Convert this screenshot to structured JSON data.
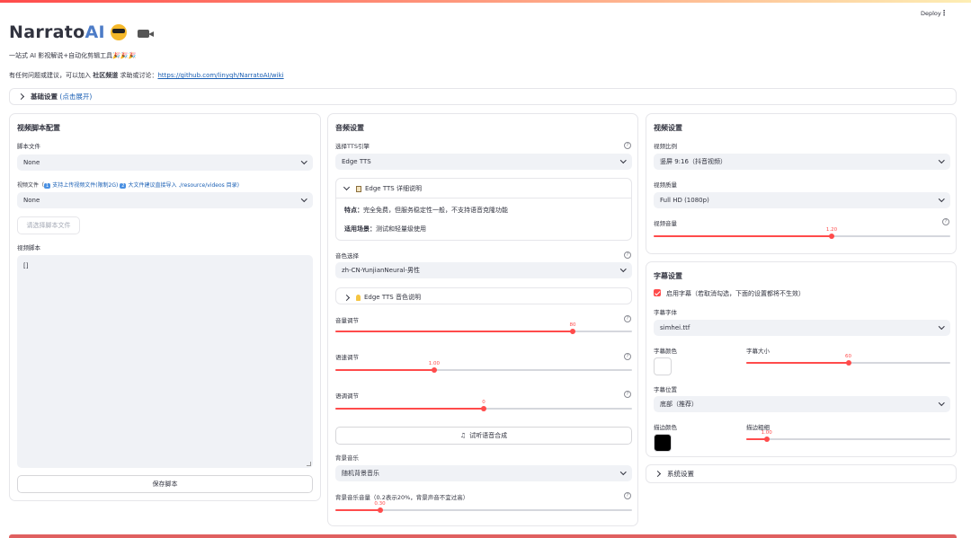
{
  "header": {
    "deploy_label": "Deploy",
    "menu_icon": "kebab-icon"
  },
  "app": {
    "title_main": "Narrato",
    "title_ai": "AI",
    "subtitle": "一站式 AI 影视解说+自动化剪辑工具🎉🎉🎉",
    "help_prefix": "有任何问题或建议，可以加入 ",
    "help_bold": "社区频道",
    "help_middle": " 求助或讨论：",
    "help_link": "https://github.com/linyqh/NarratoAI/wiki"
  },
  "basic_settings": {
    "label": "基础设置",
    "hint": "(点击展开)"
  },
  "script_panel": {
    "title": "视频脚本配置",
    "script_file_label": "脚本文件",
    "script_file_value": "None",
    "video_file_label_prefix": "视频文件（",
    "video_file_tag1": "1",
    "video_file_text1": "支持上传视频文件(限制2G) ",
    "video_file_tag2": "2",
    "video_file_text2": "大文件建议直接导入 ./resource/videos 目录)",
    "video_file_value": "None",
    "choose_script_btn": "请选择脚本文件",
    "video_script_label": "视频脚本",
    "video_script_value": "[]",
    "save_btn": "保存脚本"
  },
  "audio_panel": {
    "title": "音频设置",
    "tts_engine_label": "选择TTS引擎",
    "tts_engine_value": "Edge TTS",
    "detail_title": "Edge TTS 详细说明",
    "feature_label": "特点：",
    "feature_text": "完全免费，但服务稳定性一般，不支持语音克隆功能",
    "scene_label": "适用场景：",
    "scene_text": "测试和轻量级使用",
    "voice_label": "音色选择",
    "voice_value": "zh-CN-YunjianNeural-男性",
    "voice_info": "Edge TTS 音色说明",
    "volume_label": "音量调节",
    "volume_value": "80",
    "volume_frac": 0.8,
    "speed_label": "语速调节",
    "speed_value": "1.00",
    "speed_frac": 0.333,
    "pitch_label": "语调调节",
    "pitch_value": "0",
    "pitch_frac": 0.5,
    "preview_btn": "试听语音合成",
    "bgm_label": "背景音乐",
    "bgm_value": "随机背景音乐",
    "bgm_volume_label": "背景音乐音量（0.2表示20%，背景声音不宜过高）",
    "bgm_volume_value": "0.30",
    "bgm_volume_frac": 0.15
  },
  "video_panel": {
    "title": "视频设置",
    "ratio_label": "视频比例",
    "ratio_value": "竖屏 9:16（抖音视频）",
    "quality_label": "视频质量",
    "quality_value": "Full HD (1080p)",
    "volume_label": "视频音量",
    "volume_value": "1.20",
    "volume_frac": 0.6
  },
  "subtitle_panel": {
    "title": "字幕设置",
    "enable_label": "启用字幕（若取消勾选，下面的设置都将不生效）",
    "font_label": "字幕字体",
    "font_value": "simhei.ttf",
    "color_label": "字幕颜色",
    "color_hex": "#ffffff",
    "size_label": "字幕大小",
    "size_value": "60",
    "size_frac": 0.5,
    "position_label": "字幕位置",
    "position_value": "底部（推荐）",
    "stroke_color_label": "描边颜色",
    "stroke_color_hex": "#000000",
    "stroke_width_label": "描边粗细",
    "stroke_width_value": "1.00",
    "stroke_width_frac": 0.1
  },
  "system_settings": {
    "label": "系统设置"
  },
  "colors": {
    "accent": "#ff4b4b",
    "link": "#1a5fb4",
    "select_bg": "#f0f2f6"
  }
}
